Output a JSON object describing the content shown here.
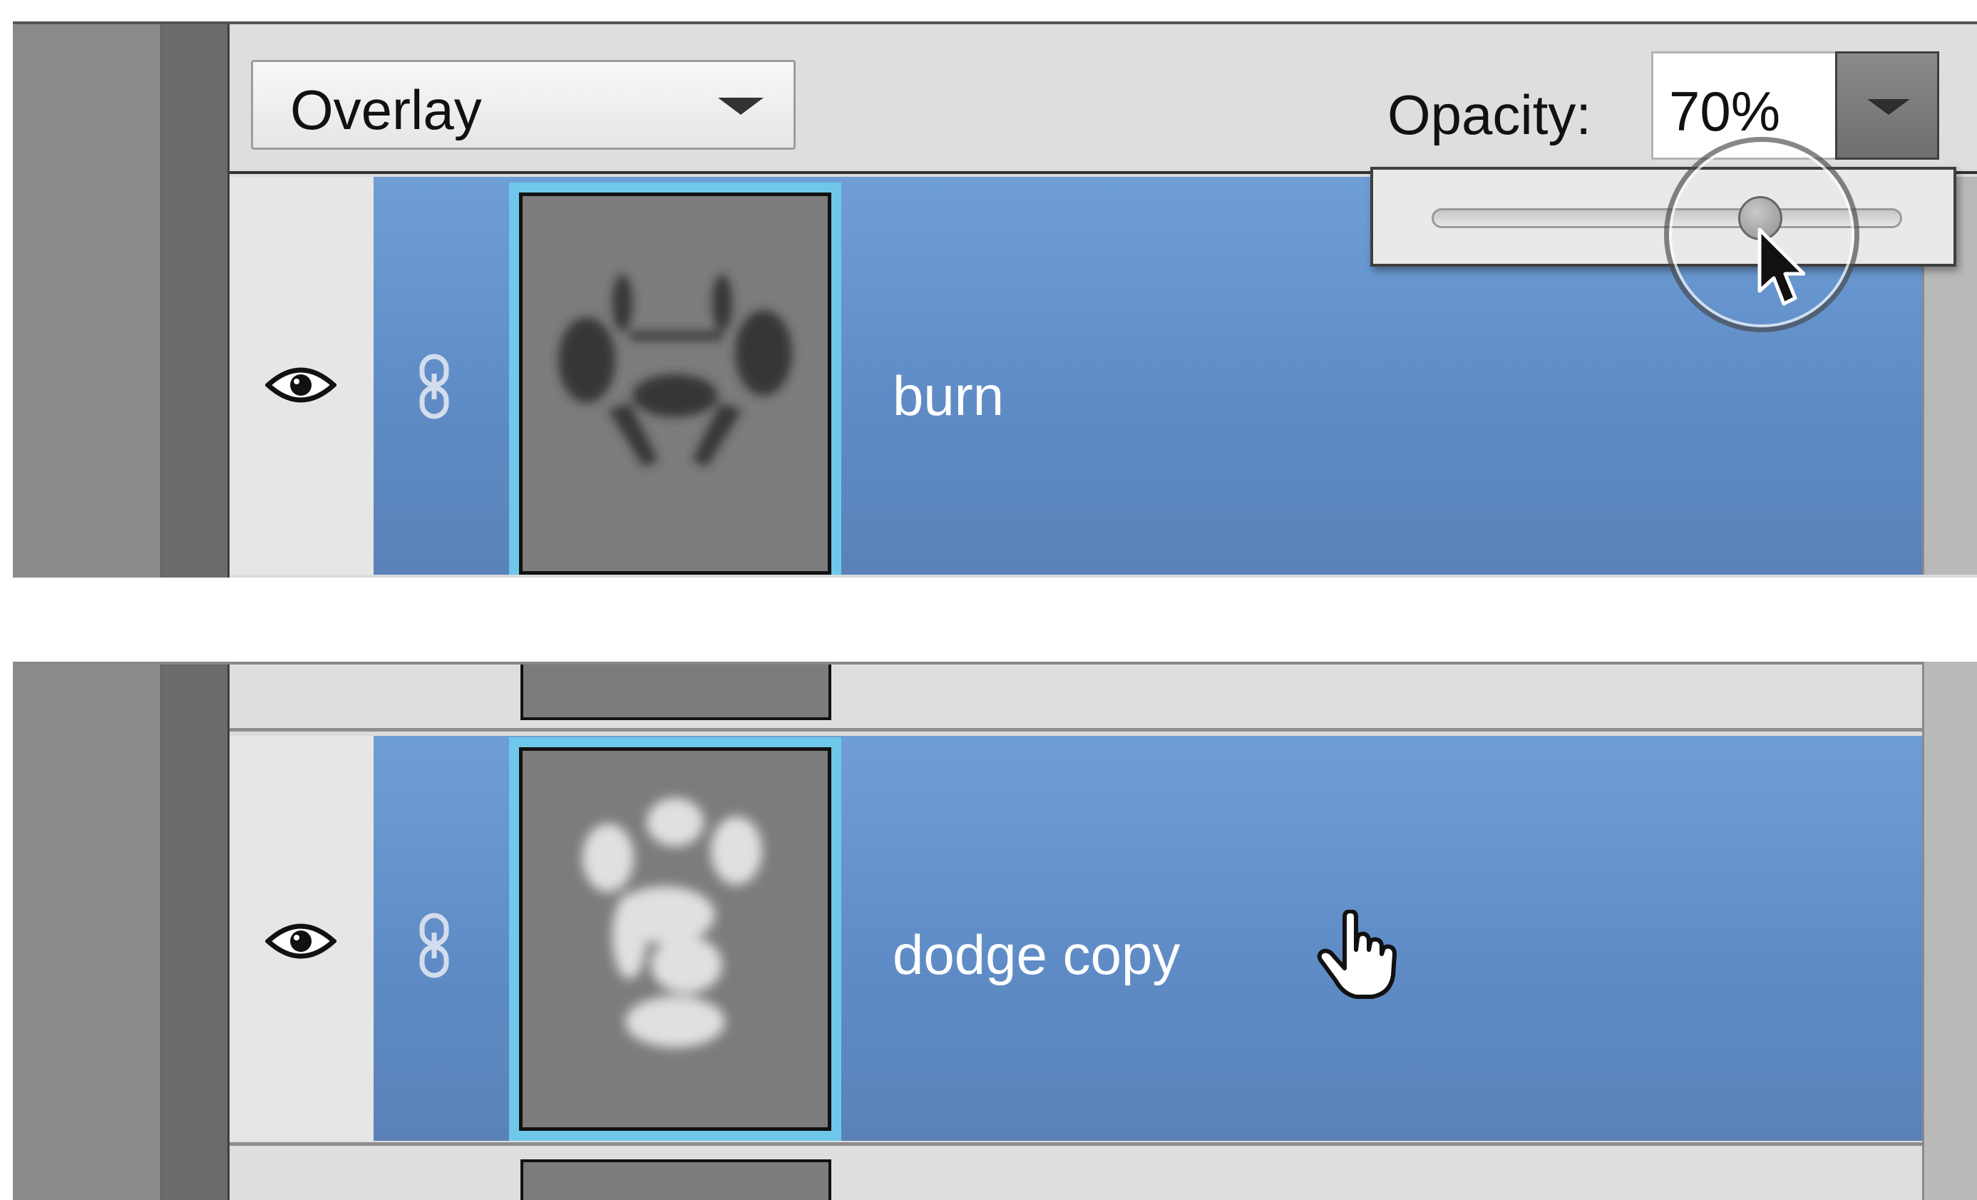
{
  "toolbar": {
    "blend_mode": "Overlay",
    "opacity_label": "Opacity:",
    "opacity_value": "70%"
  },
  "opacity_slider": {
    "level": 0.7
  },
  "layers": {
    "top": {
      "name": "burn",
      "selected": true
    },
    "bottom": {
      "name": "dodge copy",
      "selected": true
    }
  },
  "colors": {
    "selection": "#6690cf",
    "thumb_highlight": "#6fc7ea",
    "panel_bg": "#dcdcdc"
  },
  "icons": {
    "visibility": "eye-icon",
    "link": "link-icon",
    "dropdown": "chevron-down-icon",
    "cursor_top": "arrow-cursor-icon",
    "cursor_bottom": "hand-cursor-icon"
  }
}
